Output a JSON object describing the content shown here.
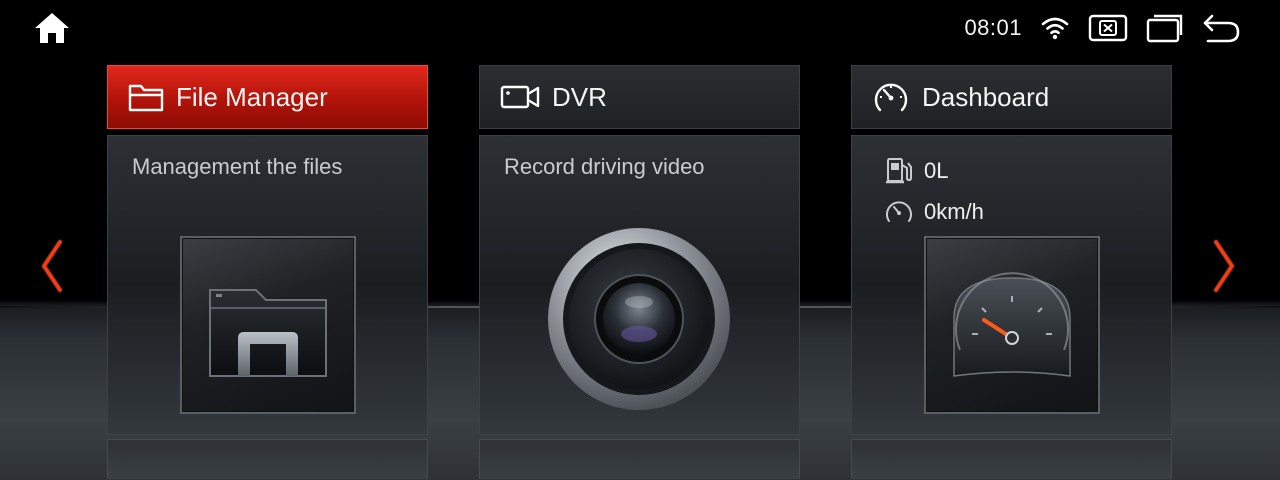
{
  "status_bar": {
    "time": "08:01",
    "icons": [
      "home-icon",
      "wifi-icon",
      "close-window-icon",
      "recent-apps-icon",
      "back-icon"
    ]
  },
  "cards": [
    {
      "title": "File Manager",
      "description": "Management the files",
      "header_icon": "folder-icon",
      "image_icon": "file-manager-app-icon",
      "active": true
    },
    {
      "title": "DVR",
      "description": "Record driving video",
      "header_icon": "camera-icon",
      "image_icon": "camera-lens-icon",
      "active": false
    },
    {
      "title": "Dashboard",
      "header_icon": "speedometer-icon",
      "image_icon": "gauge-icon",
      "fuel": "0L",
      "speed": "0km/h",
      "active": false
    }
  ],
  "navigation": {
    "prev_icon": "chevron-left-icon",
    "next_icon": "chevron-right-icon"
  },
  "colors": {
    "accent_red": "#c81a0e",
    "arrow_glow": "#ff4a1a"
  }
}
